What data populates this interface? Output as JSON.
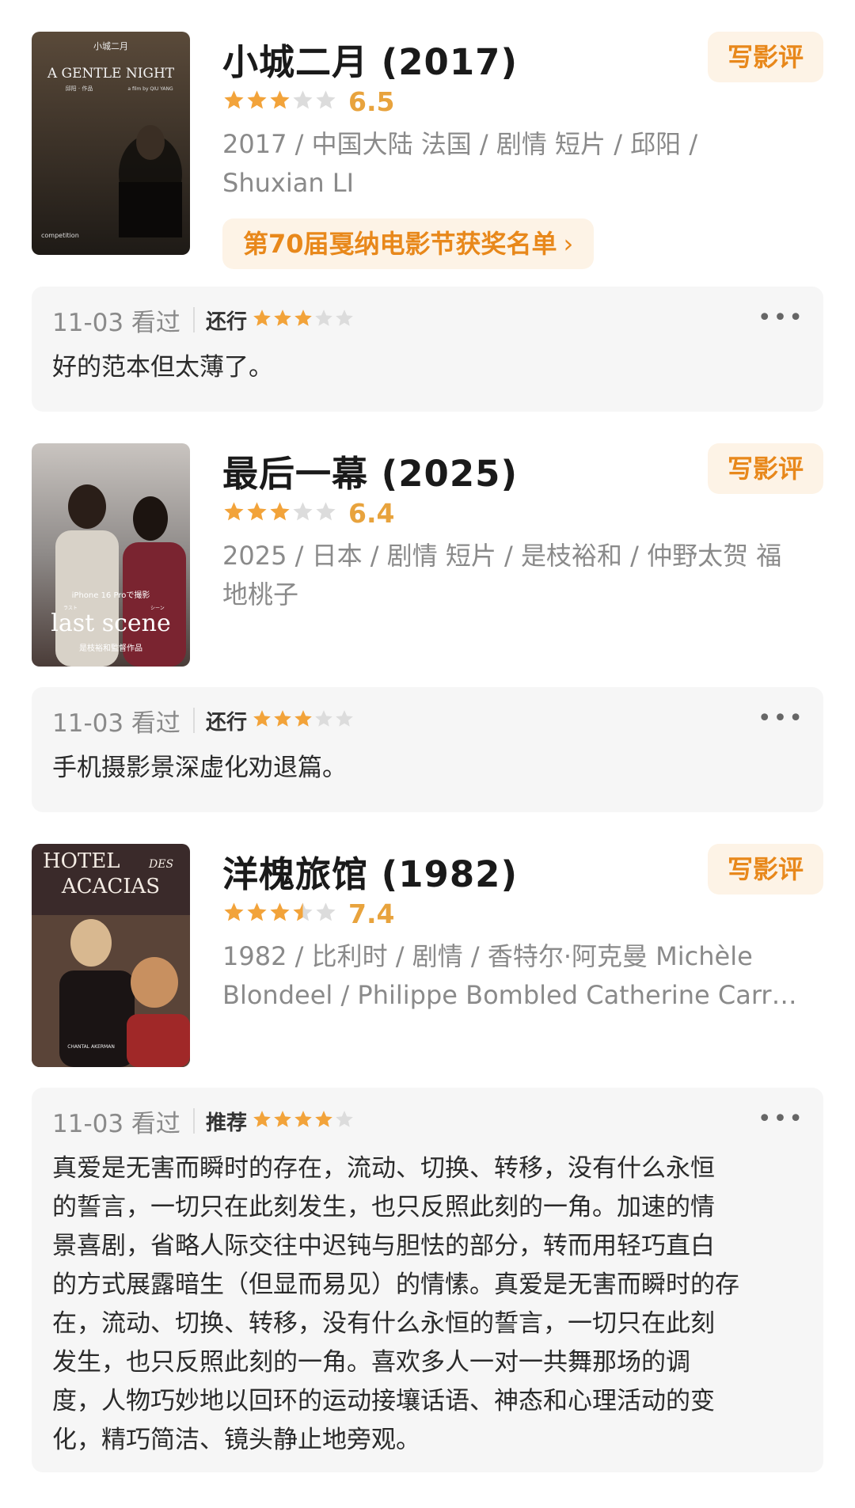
{
  "colors": {
    "accent": "#e8881b",
    "star": "#f2a33a",
    "star_empty": "#dcdcdc",
    "card_bg": "#f6f6f6"
  },
  "write_review_label": "写影评",
  "more_label": "•••",
  "movies": [
    {
      "poster": {
        "line1": "小城二月",
        "line2": "A GENTLE NIGHT",
        "line3": "邱阳 · 作品",
        "line4": "a film by QIU YANG",
        "line5": "competition"
      },
      "title": "小城二月 (2017)",
      "stars": 3,
      "score": "6.5",
      "meta_line1": "2017 / 中国大陆 法国 / 剧情 短片 / 邱阳 /",
      "meta_line2": "Shuxian LI",
      "award": "第70届戛纳电影节获奖名单",
      "award_chevron": "›",
      "review": {
        "date": "11-03 看过",
        "level": "还行",
        "stars": 3,
        "text": "好的范本但太薄了。"
      }
    },
    {
      "poster": {
        "line1": "iPhone 16 Proで撮影",
        "line2": "last scene",
        "line3": "是枝裕和監督作品",
        "line4": "ラスト",
        "line5": "シーン"
      },
      "title": "最后一幕 (2025)",
      "stars": 3,
      "score": "6.4",
      "meta_line1": "2025 / 日本 / 剧情 短片 / 是枝裕和 / 仲野太贺 福",
      "meta_line2": "地桃子",
      "review": {
        "date": "11-03 看过",
        "level": "还行",
        "stars": 3,
        "text": "手机摄影景深虚化劝退篇。"
      }
    },
    {
      "poster": {
        "line1": "HOTEL",
        "line2": "DES",
        "line3": "ACACIAS",
        "line4": "CHANTAL AKERMAN",
        "line5": ""
      },
      "title": "洋槐旅馆 (1982)",
      "stars": 3.5,
      "score": "7.4",
      "meta_line1": "1982 / 比利时 / 剧情 / 香特尔·阿克曼 Michèle",
      "meta_line2": "Blondeel / Philippe Bombled Catherine Carr…",
      "review": {
        "date": "11-03 看过",
        "level": "推荐",
        "stars": 4,
        "lines": [
          "真爱是无害而瞬时的存在，流动、切换、转移，没有什么永恒",
          "的誓言，一切只在此刻发生，也只反照此刻的一角。加速的情",
          "景喜剧，省略人际交往中迟钝与胆怯的部分，转而用轻巧直白",
          "的方式展露暗生（但显而易见）的情愫。真爱是无害而瞬时的存",
          "在，流动、切换、转移，没有什么永恒的誓言，一切只在此刻",
          "发生，也只反照此刻的一角。喜欢多人一对一共舞那场的调",
          "度，人物巧妙地以回环的运动接壤话语、神态和心理活动的变",
          "化，精巧简洁、镜头静止地旁观。"
        ]
      }
    }
  ]
}
